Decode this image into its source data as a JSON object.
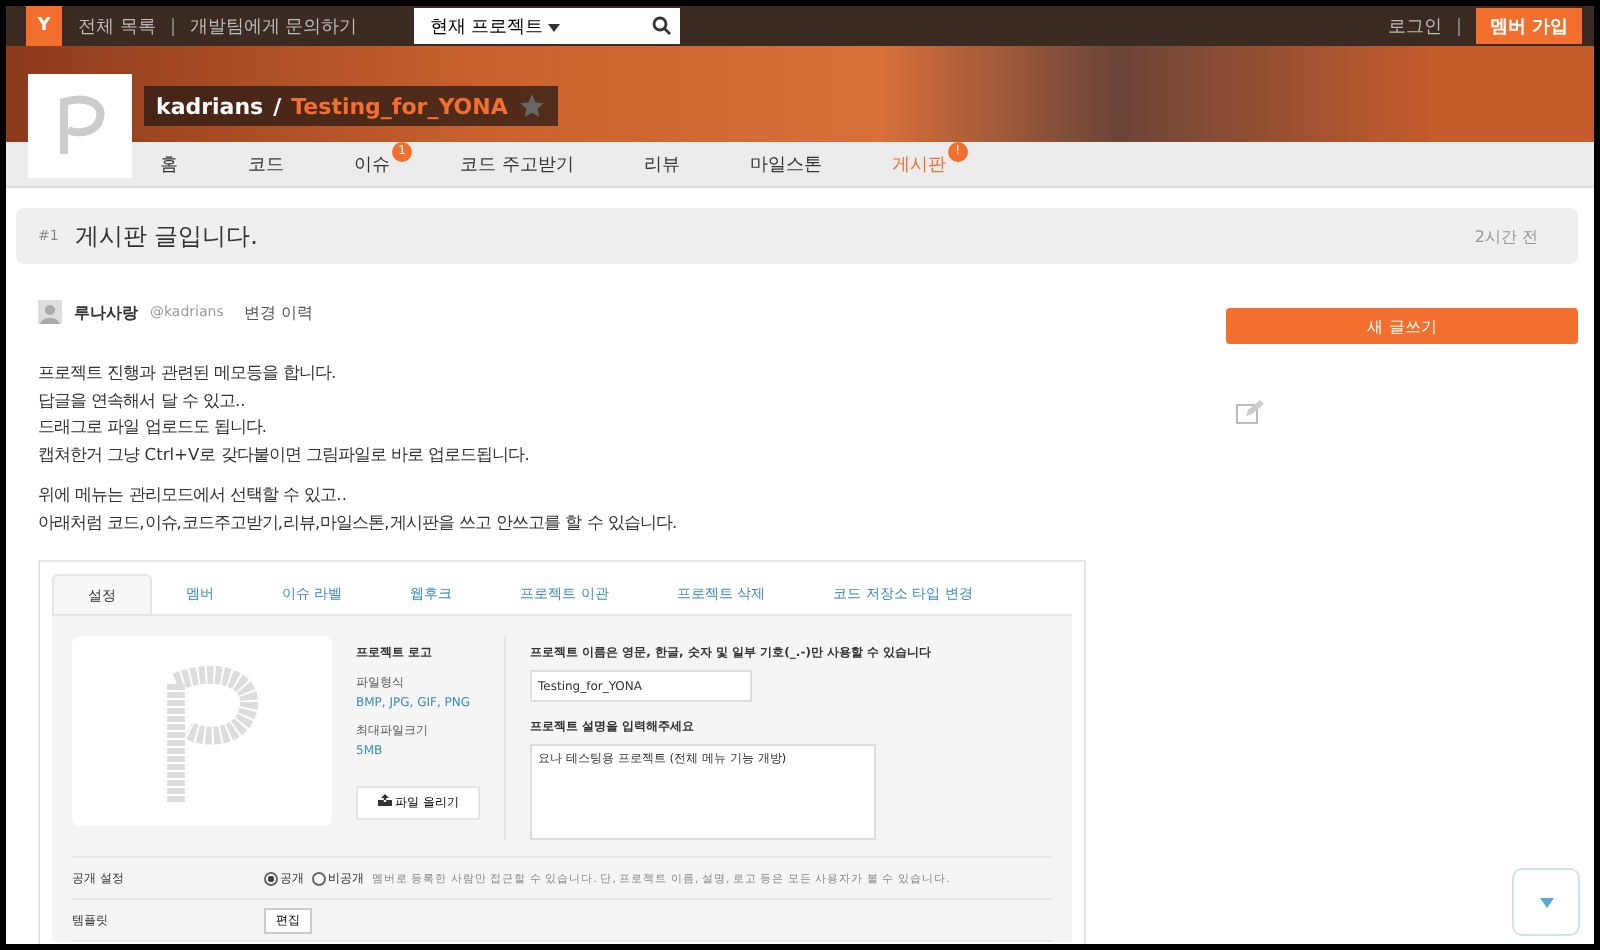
{
  "top_bar": {
    "logo": "Y",
    "links": [
      "전체 목록",
      "개발팀에게 문의하기"
    ],
    "project_select": "현재 프로젝트",
    "login": "로그인",
    "signup": "멤버 가입"
  },
  "project": {
    "owner": "kadrians",
    "separator": "/",
    "name": "Testing_for_YONA",
    "starred": false
  },
  "nav": [
    {
      "label": "홈",
      "selected": false
    },
    {
      "label": "코드",
      "selected": false
    },
    {
      "label": "이슈",
      "selected": false,
      "badge": "1"
    },
    {
      "label": "코드 주고받기",
      "selected": false
    },
    {
      "label": "리뷰",
      "selected": false
    },
    {
      "label": "마일스톤",
      "selected": false
    },
    {
      "label": "게시판",
      "selected": true,
      "badge": "!"
    }
  ],
  "post": {
    "number": "#1",
    "title": "게시판 글입니다.",
    "time": "2시간 전",
    "author": "루나사랑",
    "handle": "@kadrians",
    "history": "변경 이력",
    "paragraphs": [
      [
        "프로젝트 진행과 관련된 메모등을 합니다.",
        "답글을 연속해서 달 수 있고..",
        "드래그로 파일 업로드도 됩니다.",
        "캡쳐한거 그냥 Ctrl+V로 갖다붙이면 그림파일로 바로 업로드됩니다."
      ],
      [
        "위에 메뉴는 관리모드에서 선택할 수 있고..",
        "아래처럼 코드,이슈,코드주고받기,리뷰,마일스톤,게시판을 쓰고 안쓰고를 할 수 있습니다."
      ]
    ]
  },
  "embedded": {
    "tabs": [
      {
        "label": "설정",
        "selected": true
      },
      {
        "label": "멤버",
        "selected": false
      },
      {
        "label": "이슈 라벨",
        "selected": false
      },
      {
        "label": "웹후크",
        "selected": false
      },
      {
        "label": "프로젝트 이관",
        "selected": false
      },
      {
        "label": "프로젝트 삭제",
        "selected": false
      },
      {
        "label": "코드 저장소 타입 변경",
        "selected": false
      }
    ],
    "logo_title": "프로젝트 로고",
    "format_label": "파일형식",
    "format_value": "BMP, JPG, GIF, PNG",
    "size_label": "최대파일크기",
    "size_value": "5MB",
    "upload_button": "파일 올리기",
    "name_label": "프로젝트 이름은 영문, 한글, 숫자 및 일부 기호(_.-)만 사용할 수 있습니다",
    "name_value": "Testing_for_YONA",
    "desc_label": "프로젝트 설명을 입력해주세요",
    "desc_value": "요나 테스팅용 프로젝트 (전체 메뉴 기능 개방)",
    "visibility_label": "공개 설정",
    "visibility": [
      {
        "label": "공개",
        "selected": true
      },
      {
        "label": "비공개",
        "selected": false
      }
    ],
    "visibility_note": "멤버로 등록한 사람만 접근할 수 있습니다. 단, 프로젝트 이름, 설명, 로고 등은 모든 사용자가 볼 수 있습니다.",
    "template_label": "템플릿",
    "template_button": "편집"
  },
  "sidebar": {
    "new_post": "새 글쓰기"
  }
}
